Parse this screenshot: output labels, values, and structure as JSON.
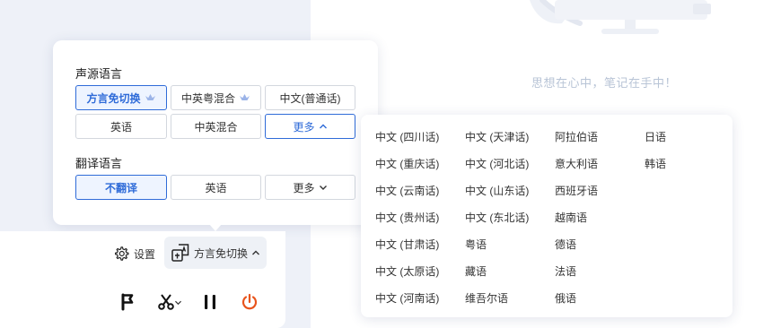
{
  "right": {
    "slogan": "思想在心中，笔记在手中！"
  },
  "source_lang": {
    "title": "声源语言",
    "options": [
      {
        "label": "方言免切换",
        "vip": true,
        "state": "selected"
      },
      {
        "label": "中英粤混合",
        "vip": true,
        "state": "normal"
      },
      {
        "label": "中文(普通话)",
        "vip": false,
        "state": "normal"
      },
      {
        "label": "英语",
        "vip": false,
        "state": "normal"
      },
      {
        "label": "中英混合",
        "vip": false,
        "state": "normal"
      },
      {
        "label": "更多",
        "chevron": "chevron-up-icon",
        "state": "expanded"
      }
    ]
  },
  "translate_lang": {
    "title": "翻译语言",
    "options": [
      {
        "label": "不翻译",
        "state": "selected"
      },
      {
        "label": "英语",
        "state": "normal"
      },
      {
        "label": "更多",
        "chevron": "chevron-down-icon",
        "state": "normal"
      }
    ]
  },
  "more_languages": [
    [
      "中文 (四川话)",
      "中文 (天津话)",
      "阿拉伯语",
      "日语"
    ],
    [
      "中文 (重庆话)",
      "中文 (河北话)",
      "意大利语",
      "韩语"
    ],
    [
      "中文 (云南话)",
      "中文 (山东话)",
      "西班牙语",
      ""
    ],
    [
      "中文 (贵州话)",
      "中文 (东北话)",
      "越南语",
      ""
    ],
    [
      "中文 (甘肃话)",
      "粤语",
      "德语",
      ""
    ],
    [
      "中文 (太原话)",
      "藏语",
      "法语",
      ""
    ],
    [
      "中文 (河南话)",
      "维吾尔语",
      "俄语",
      ""
    ]
  ],
  "bottom": {
    "settings_label": "设置",
    "dialect_label": "方言免切换"
  },
  "colors": {
    "accent": "#2f6bd8",
    "power": "#e8541c",
    "crown": "#9cb4e8"
  }
}
